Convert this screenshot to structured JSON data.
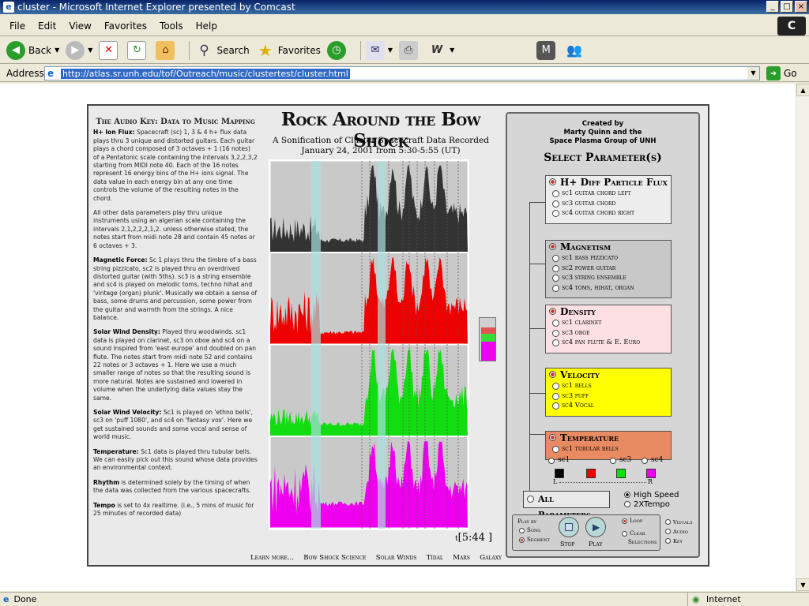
{
  "window": {
    "title": "cluster - Microsoft Internet Explorer presented by Comcast"
  },
  "menu": [
    "File",
    "Edit",
    "View",
    "Favorites",
    "Tools",
    "Help"
  ],
  "toolbar": {
    "back": "Back",
    "search": "Search",
    "favorites": "Favorites"
  },
  "address": {
    "label": "Address",
    "url": "http://atlas.sr.unh.edu/tof/Outreach/music/clustertest/cluster.html",
    "go": "Go"
  },
  "status": {
    "left": "Done",
    "zone": "Internet"
  },
  "page": {
    "audio_key_title": "The Audio Key: Data to Music Mapping",
    "paragraphs": [
      {
        "bold": "H+ Ion Flux:",
        "text": " Spacecraft (sc) 1, 3 & 4 h+ flux data plays thru 3 unique and distorted guitars. Each guitar plays a chord composed of 3 octaves + 1 (16 notes) of a Pentatonic scale containing the intervals 3,2,2,3,2 starting from MIDI note 40. Each of the 16 notes represent 16 energy bins of the H+ ions signal. The data value in each energy bin at any one time controls the volume of the resulting notes in the chord."
      },
      {
        "bold": "",
        "text": "All other data parameters play thru unique instruments using an algerian scale containing the intervals 2,1,2,2,2,1,2. unless otherwise stated, the notes start from midi note 28 and contain 45 notes or 6 octaves + 3."
      },
      {
        "bold": "Magnetic Force:",
        "text": " Sc 1 plays thru the timbre of a bass string pizzicato, sc2 is played thru an overdrived distorted guitar (with 5ths). sc3 is a string ensemble and sc4 is played on melodic toms, techno hihat and 'vintage (organ) plunk'. Musically we obtain a sense of bass, some drums and percussion, some power from the guitar and warmth from the strings. A nice balance."
      },
      {
        "bold": "Solar Wind Density:",
        "text": " Played thru woodwinds. sc1 data is played on clarinet, sc3 on oboe and sc4 on a sound inspired from 'east europe' and doubled on pan flute. The notes start from midi note 52 and contains 22 notes or 3 octaves + 1. Here we use a much smaller range of notes so that the resulting sound is more natural. Notes are sustained and lowered in volume when the underlying data values stay the same."
      },
      {
        "bold": "Solar Wind Velocity:",
        "text": " Sc1 is played on 'ethno bells', sc3 on 'puff 1080', and sc4 on 'fantasy vox'. Here we get sustained sounds and some vocal and sense of world music."
      },
      {
        "bold": "Temperature:",
        "text": " Sc1 data is played thru tubular bells. We can easily pick out this sound whose data provides an environmental context."
      },
      {
        "bold": "Rhythm",
        "text": " is determined solely by the timing of when the data was collected from the various spacecrafts."
      },
      {
        "bold": "Tempo",
        "text": " is set to 4x realtime. (i.e., 5 mins of music for 25 minutes of recorded data)"
      }
    ],
    "title": "Rock Around the Bow Shock",
    "subtitle1": "A Sonification of Cluster Spacecraft Data Recorded",
    "subtitle2": "January 24, 2001 from 5:30-5:55 (UT)",
    "timer": "[5:44 ]",
    "nav": [
      "Learn more...",
      "Bow Shock Science",
      "Solar Winds",
      "Tidal",
      "Mars",
      "Galaxy"
    ],
    "credit": [
      "Created by",
      "Marty Quinn and the",
      "Space Plasma Group of UNH"
    ],
    "select_head": "Select Parameter(s)",
    "params": [
      {
        "name": "H+ Diff Particle Flux",
        "bg": "#ededed",
        "items": [
          "sc1 guitar chord left",
          "sc3 guitar chord",
          "sc4 guitar chord right"
        ]
      },
      {
        "name": "Magnetism",
        "bg": "#c8c8c8",
        "items": [
          "sc1 bass pizzicato",
          "sc2 power guitar",
          "sc3 string ensemble",
          "sc4 toms, hihat, organ"
        ]
      },
      {
        "name": "Density",
        "bg": "#fde0e4",
        "items": [
          "sc1 clarinet",
          "sc3 oboe",
          "sc4 pan flute & E. Euro"
        ]
      },
      {
        "name": "Velocity",
        "bg": "#ffff00",
        "items": [
          "sc1 bells",
          "sc3 puff",
          "sc4 Vocal"
        ]
      },
      {
        "name": "Temperature",
        "bg": "#e98b62",
        "items": [
          "sc1 tubular bells"
        ]
      }
    ],
    "sc_labels": [
      "sc1",
      "sc3",
      "sc4"
    ],
    "lr": {
      "l": "L",
      "r": "R"
    },
    "all_params": "All Parameters",
    "speed": [
      "High Speed",
      "2XTempo"
    ],
    "play": {
      "play_by": "Play by",
      "song": "Song",
      "segment": "Segment",
      "stop": "Stop",
      "play": "Play",
      "loop": "Loop",
      "clear": "Clear",
      "selections": "Selections",
      "visuals": "Visuals",
      "audio": "Audio",
      "key": "Key"
    }
  },
  "colors": {
    "flux": "#333333",
    "mag": "#ee0000",
    "dens": "#11dd11",
    "vel": "#ee00ee"
  }
}
